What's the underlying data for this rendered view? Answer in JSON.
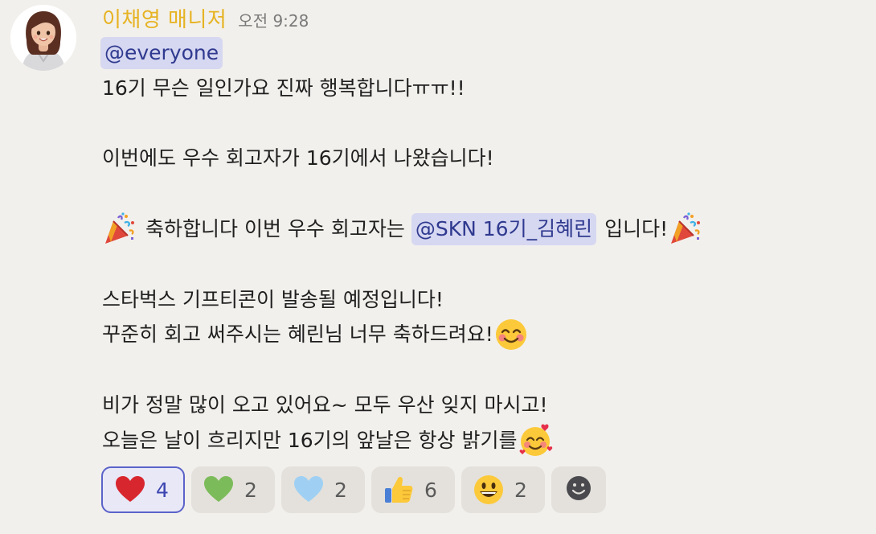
{
  "message": {
    "sender": "이채영 매니저",
    "time": "오전 9:28",
    "mention_everyone": "@everyone",
    "lines": {
      "l1": "16기 무슨 일인가요 진짜 행복합니다ㅠㅠ!!",
      "l2": "이번에도 우수 회고자가 16기에서 나왔습니다!",
      "l3_pre": "축하합니다 이번 우수 회고자는",
      "l3_mention": "@SKN 16기_김혜린",
      "l3_post": "입니다!",
      "l4": "스타벅스 기프티콘이 발송될 예정입니다!",
      "l5": "꾸준히 회고 써주시는 혜린님 너무 축하드려요!",
      "l6": "비가 정말 많이 오고 있어요~ 모두 우산 잊지 마시고!",
      "l7": "오늘은 날이 흐리지만 16기의 앞날은 항상 밝기를"
    },
    "emojis": [
      "party-popper",
      "party-popper",
      "smiling-face-with-blush",
      "smiling-face-with-hearts"
    ]
  },
  "reactions": [
    {
      "emoji": "red-heart",
      "count": "4",
      "active": true
    },
    {
      "emoji": "green-heart",
      "count": "2",
      "active": false
    },
    {
      "emoji": "blue-heart",
      "count": "2",
      "active": false
    },
    {
      "emoji": "thumbs-up",
      "count": "6",
      "active": false
    },
    {
      "emoji": "grinning-face",
      "count": "2",
      "active": false
    }
  ],
  "add_reaction_icon": "add-reaction-icon",
  "colors": {
    "background": "#f2f0ec",
    "sender": "#e6b322",
    "mention_bg": "#d6d7f1",
    "mention_text": "#2f3a8f",
    "active_reaction_border": "#5b63c9"
  }
}
